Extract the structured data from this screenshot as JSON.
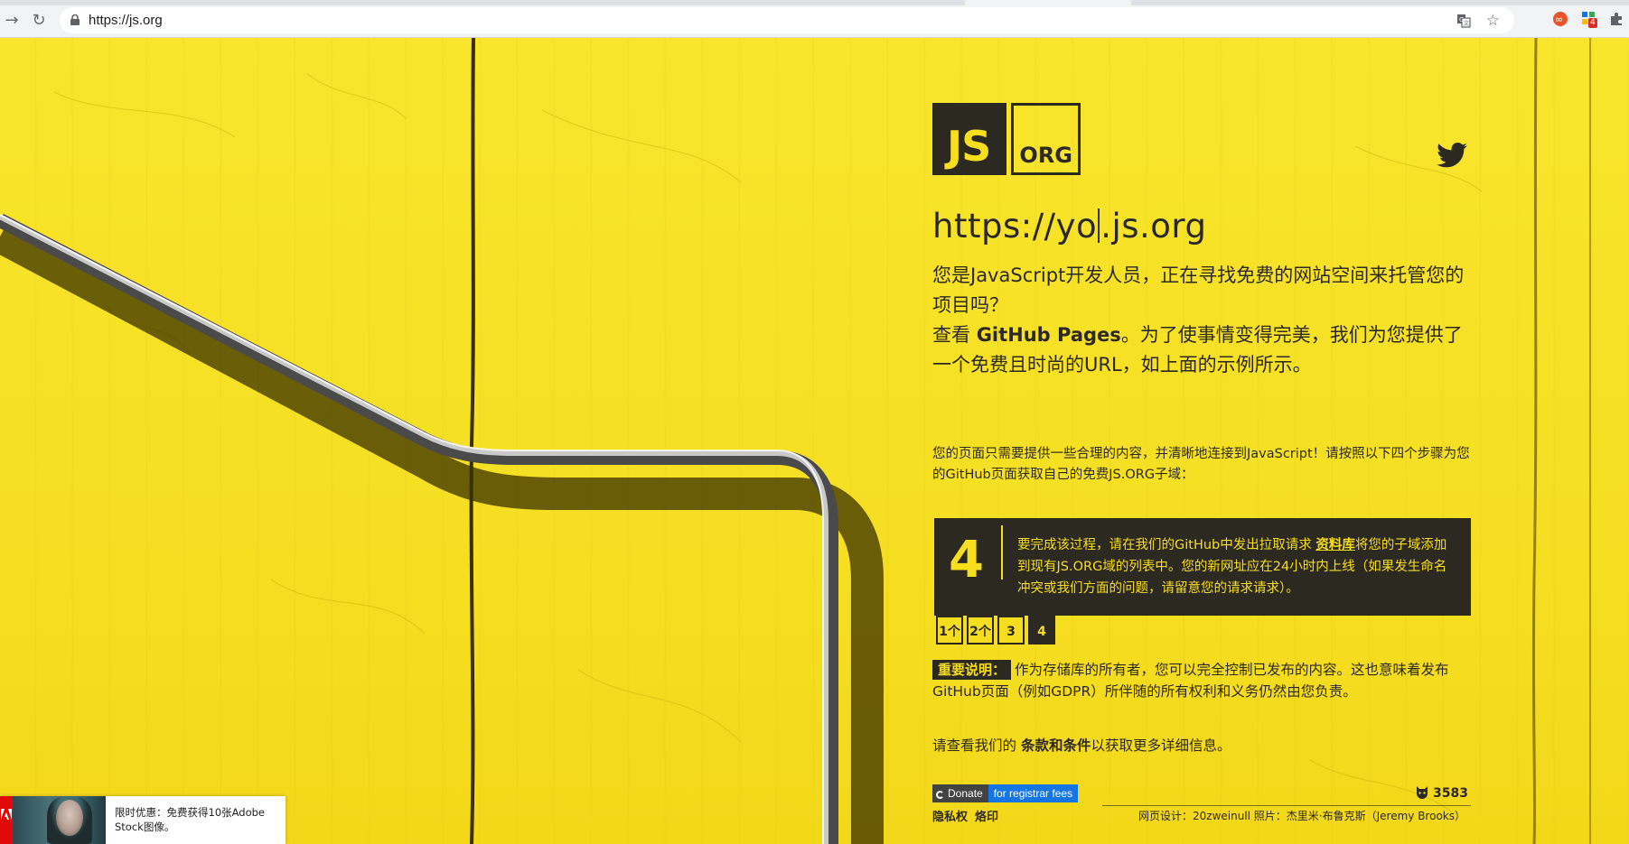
{
  "browser": {
    "url": "https://js.org",
    "extension_badge": "4"
  },
  "page": {
    "big_url": {
      "prefix": "https://",
      "middle": "yo",
      "suffix": ".js.org"
    },
    "logo": {
      "js": "JS",
      "org": "ORG"
    },
    "intro": {
      "line1": "您是JavaScript开发人员，正在寻找免费的网站空间来托管您的项目吗？",
      "line2_pre": "查看 ",
      "line2_bold": "GitHub Pages",
      "line2_post": "。为了使事情变得完美，我们为您提供了一个免费且时尚的URL，如上面的示例所示。"
    },
    "steps_intro": "您的页面只需要提供一些合理的内容，并清晰地连接到JavaScript！请按照以下四个步骤为您的GitHub页面获取自己的免费JS.ORG子域：",
    "step": {
      "number": "4",
      "text_pre": "要完成该过程，请在我们的GitHub中发出拉取请求 ",
      "text_bold": "资料库",
      "text_post": "将您的子域添加到现有JS.ORG域的列表中。您的新网址应在24小时内上线（如果发生命名冲突或我们方面的问题，请留意您的请求请求）。"
    },
    "step_tabs": [
      "1个",
      "2个",
      "3",
      "4"
    ],
    "important": {
      "badge": "重要说明：",
      "text": "作为存储库的所有者，您可以完全控制已发布的内容。这也意味着发布GitHub页面（例如GDPR）所伴随的所有权利和义务仍然由您负责。"
    },
    "terms": {
      "pre": "请查看我们的 ",
      "bold": "条款和条件",
      "post": "以获取更多详细信息。"
    },
    "donate": {
      "label": "Donate",
      "sub": "for registrar fees"
    },
    "stars": "3583",
    "footer": {
      "privacy": "隐私权",
      "imprint": "烙印",
      "credits": "网页设计：20zweinull 照片：杰里米·布鲁克斯（Jeremy Brooks）"
    }
  },
  "ad": {
    "text": "限时优惠：免费获得10张Adobe Stock图像。"
  },
  "colors": {
    "yellow": "#f7df1e",
    "dark": "#2c2921",
    "donate_blue": "#1476e4"
  }
}
